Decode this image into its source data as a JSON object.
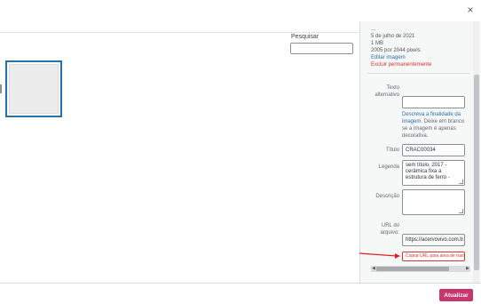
{
  "header": {
    "close_icon": "close-icon",
    "close_glyph": "×"
  },
  "toolbar": {
    "search_label": "Pesquisar",
    "search_value": ""
  },
  "media_item": {
    "selected": true
  },
  "details": {
    "filename_partial": "…",
    "date": "5 de julho de 2021",
    "filesize": "1 MB",
    "dimensions": "2005 por 2044 pixels",
    "edit_link": "Editar imagem",
    "delete_link": "Excluir permanentemente"
  },
  "fields": {
    "alt_label": "Texto alternativo",
    "alt_value": "",
    "alt_help_link": "Descreva a finalidade da imagem",
    "alt_help_rest": ". Deixe em branco se a imagem é apenas decorativa.",
    "title_label": "Título",
    "title_value": "CRAC00034",
    "caption_label": "Legenda",
    "caption_value": "sem título, 2017 - cerâmica fixa a estrutura de ferro -",
    "description_label": "Descrição",
    "description_value": "",
    "url_label": "URL do arquivo:",
    "url_value": "https://acervovivo.com.b",
    "copy_button": "Copiar URL para área de transfe"
  },
  "footer": {
    "update_button": "Atualizar"
  },
  "colors": {
    "accent": "#2271b1",
    "danger": "#d63638",
    "update": "#c9356e"
  }
}
